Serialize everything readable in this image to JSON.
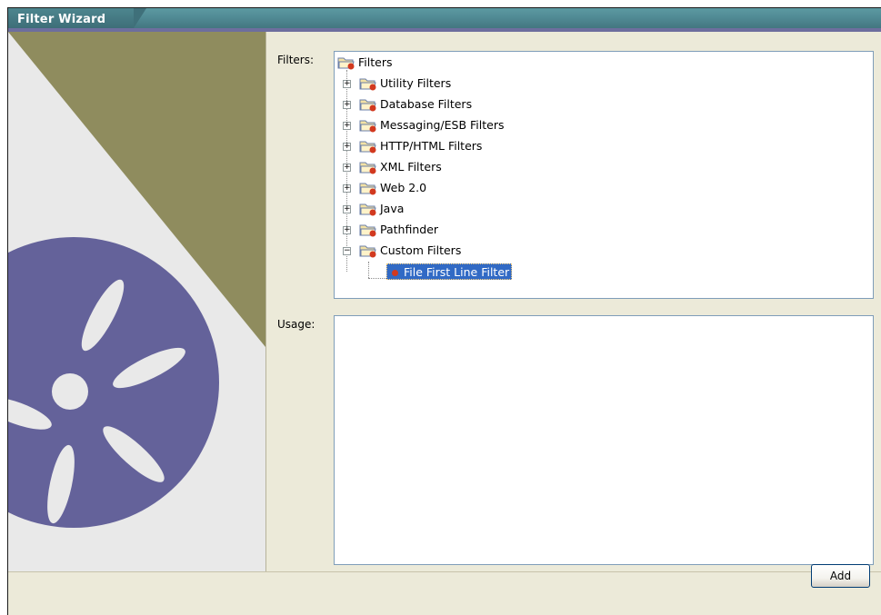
{
  "window": {
    "title": "Filter Wizard"
  },
  "labels": {
    "filters": "Filters:",
    "usage": "Usage:"
  },
  "tree": {
    "root": "Filters",
    "categories": [
      "Utility Filters",
      "Database Filters",
      "Messaging/ESB Filters",
      "HTTP/HTML Filters",
      "XML Filters",
      "Web 2.0",
      "Java",
      "Pathfinder",
      "Custom Filters"
    ],
    "expanded_category": "Custom Filters",
    "children": [
      "File First Line Filter"
    ],
    "selected_item": "File First Line Filter"
  },
  "usage": {
    "text": ""
  },
  "buttons": {
    "add": "Add"
  },
  "colors": {
    "title_bar": "#4f8892",
    "panel_bg": "#ecead9",
    "logo_purple": "#64629a",
    "olive": "#8f8c5e",
    "selection": "#316ac5"
  }
}
